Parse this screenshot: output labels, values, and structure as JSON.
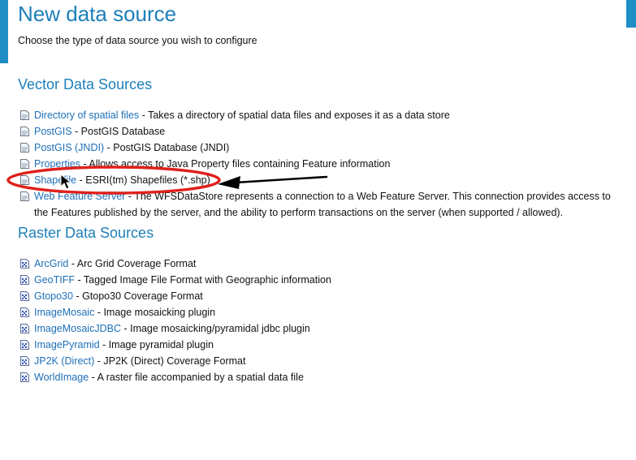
{
  "page": {
    "title": "New data source",
    "subtitle": "Choose the type of data source you wish to configure"
  },
  "vector": {
    "heading": "Vector Data Sources",
    "items": [
      {
        "label": "Directory of spatial files",
        "desc": " - Takes a directory of spatial data files and exposes it as a data store"
      },
      {
        "label": "PostGIS",
        "desc": " - PostGIS Database"
      },
      {
        "label": "PostGIS (JNDI)",
        "desc": " - PostGIS Database (JNDI)"
      },
      {
        "label": "Properties",
        "desc": " - Allows access to Java Property files containing Feature information"
      },
      {
        "label": "Shapefile",
        "desc": " - ESRI(tm) Shapefiles (*.shp)"
      },
      {
        "label": "Web Feature Server",
        "desc": " - The WFSDataStore represents a connection to a Web Feature Server. This connection provides access to the Features published by the server, and the ability to perform transactions on the server (when supported / allowed)."
      }
    ]
  },
  "raster": {
    "heading": "Raster Data Sources",
    "items": [
      {
        "label": "ArcGrid",
        "desc": " - Arc Grid Coverage Format"
      },
      {
        "label": "GeoTIFF",
        "desc": " - Tagged Image File Format with Geographic information"
      },
      {
        "label": "Gtopo30",
        "desc": " - Gtopo30 Coverage Format"
      },
      {
        "label": "ImageMosaic",
        "desc": " - Image mosaicking plugin"
      },
      {
        "label": "ImageMosaicJDBC",
        "desc": " - Image mosaicking/pyramidal jdbc plugin"
      },
      {
        "label": "ImagePyramid",
        "desc": " - Image pyramidal plugin"
      },
      {
        "label": "JP2K (Direct)",
        "desc": " - JP2K (Direct) Coverage Format"
      },
      {
        "label": "WorldImage",
        "desc": " - A raster file accompanied by a spatial data file"
      }
    ]
  },
  "colors": {
    "accent": "#1d7fb9",
    "link": "#1d6fb8",
    "annotation_ellipse": "#e0201b",
    "annotation_arrow": "#000000"
  }
}
